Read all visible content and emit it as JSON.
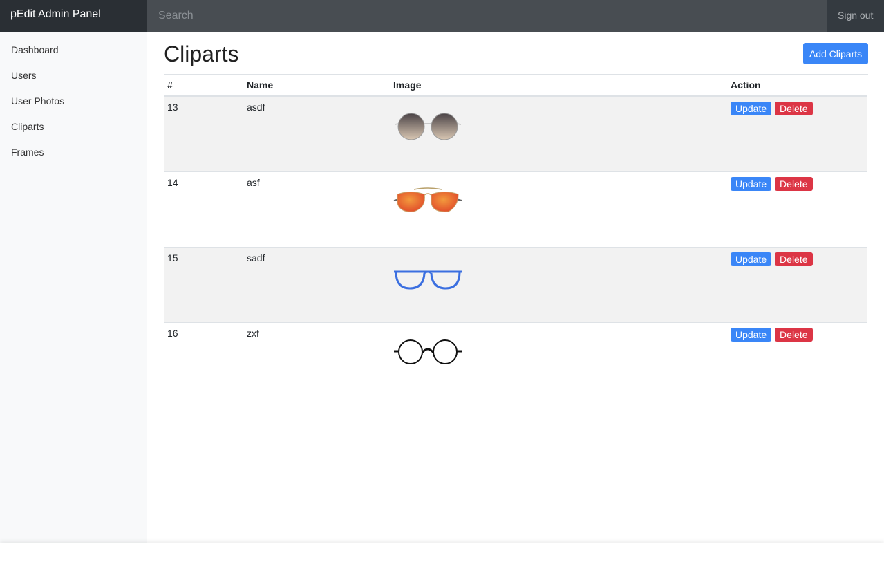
{
  "header": {
    "brand": "pEdit Admin Panel",
    "search_placeholder": "Search",
    "signout": "Sign out"
  },
  "sidebar": {
    "items": [
      {
        "label": "Dashboard"
      },
      {
        "label": "Users"
      },
      {
        "label": "User Photos"
      },
      {
        "label": "Cliparts"
      },
      {
        "label": "Frames"
      }
    ]
  },
  "main": {
    "title": "Cliparts",
    "add_button": "Add Cliparts",
    "columns": [
      "#",
      "Name",
      "Image",
      "Action"
    ],
    "update_label": "Update",
    "delete_label": "Delete",
    "rows": [
      {
        "id": "13",
        "name": "asdf",
        "image_icon": "gradient-round-sunglasses-icon"
      },
      {
        "id": "14",
        "name": "asf",
        "image_icon": "orange-aviator-sunglasses-icon"
      },
      {
        "id": "15",
        "name": "sadf",
        "image_icon": "blue-square-glasses-icon"
      },
      {
        "id": "16",
        "name": "zxf",
        "image_icon": "black-round-glasses-icon"
      }
    ]
  }
}
